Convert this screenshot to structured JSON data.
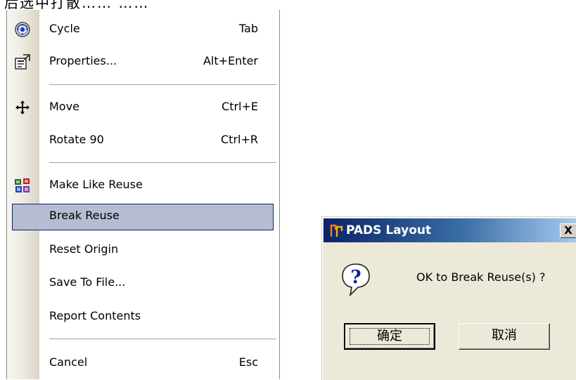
{
  "top_fragment": "后选中打散…… …… ……",
  "menu": {
    "items": [
      {
        "label": "Cycle",
        "shortcut": "Tab",
        "icon": "cycle-icon"
      },
      {
        "label": "Properties...",
        "shortcut": "Alt+Enter",
        "icon": "properties-icon"
      },
      {
        "label": "Move",
        "shortcut": "Ctrl+E",
        "icon": "move-icon"
      },
      {
        "label": "Rotate 90",
        "shortcut": "Ctrl+R",
        "icon": ""
      },
      {
        "label": "Make Like Reuse",
        "shortcut": "",
        "icon": "make-like-reuse-icon"
      },
      {
        "label": "Break Reuse",
        "shortcut": "",
        "icon": ""
      },
      {
        "label": "Reset Origin",
        "shortcut": "",
        "icon": ""
      },
      {
        "label": "Save To File...",
        "shortcut": "",
        "icon": ""
      },
      {
        "label": "Report Contents",
        "shortcut": "",
        "icon": ""
      },
      {
        "label": "Cancel",
        "shortcut": "Esc",
        "icon": ""
      }
    ],
    "selected_index": 5
  },
  "dialog": {
    "title": "PADS Layout",
    "message": "OK to Break Reuse(s) ?",
    "ok_label": "确定",
    "cancel_label": "取消",
    "close_label": "X"
  },
  "colors": {
    "selection": "#b6bdd2",
    "selection_border": "#0a246a",
    "titlebar_start": "#0a246a",
    "titlebar_end": "#a6caf0",
    "dialog_bg": "#ece9d8"
  }
}
